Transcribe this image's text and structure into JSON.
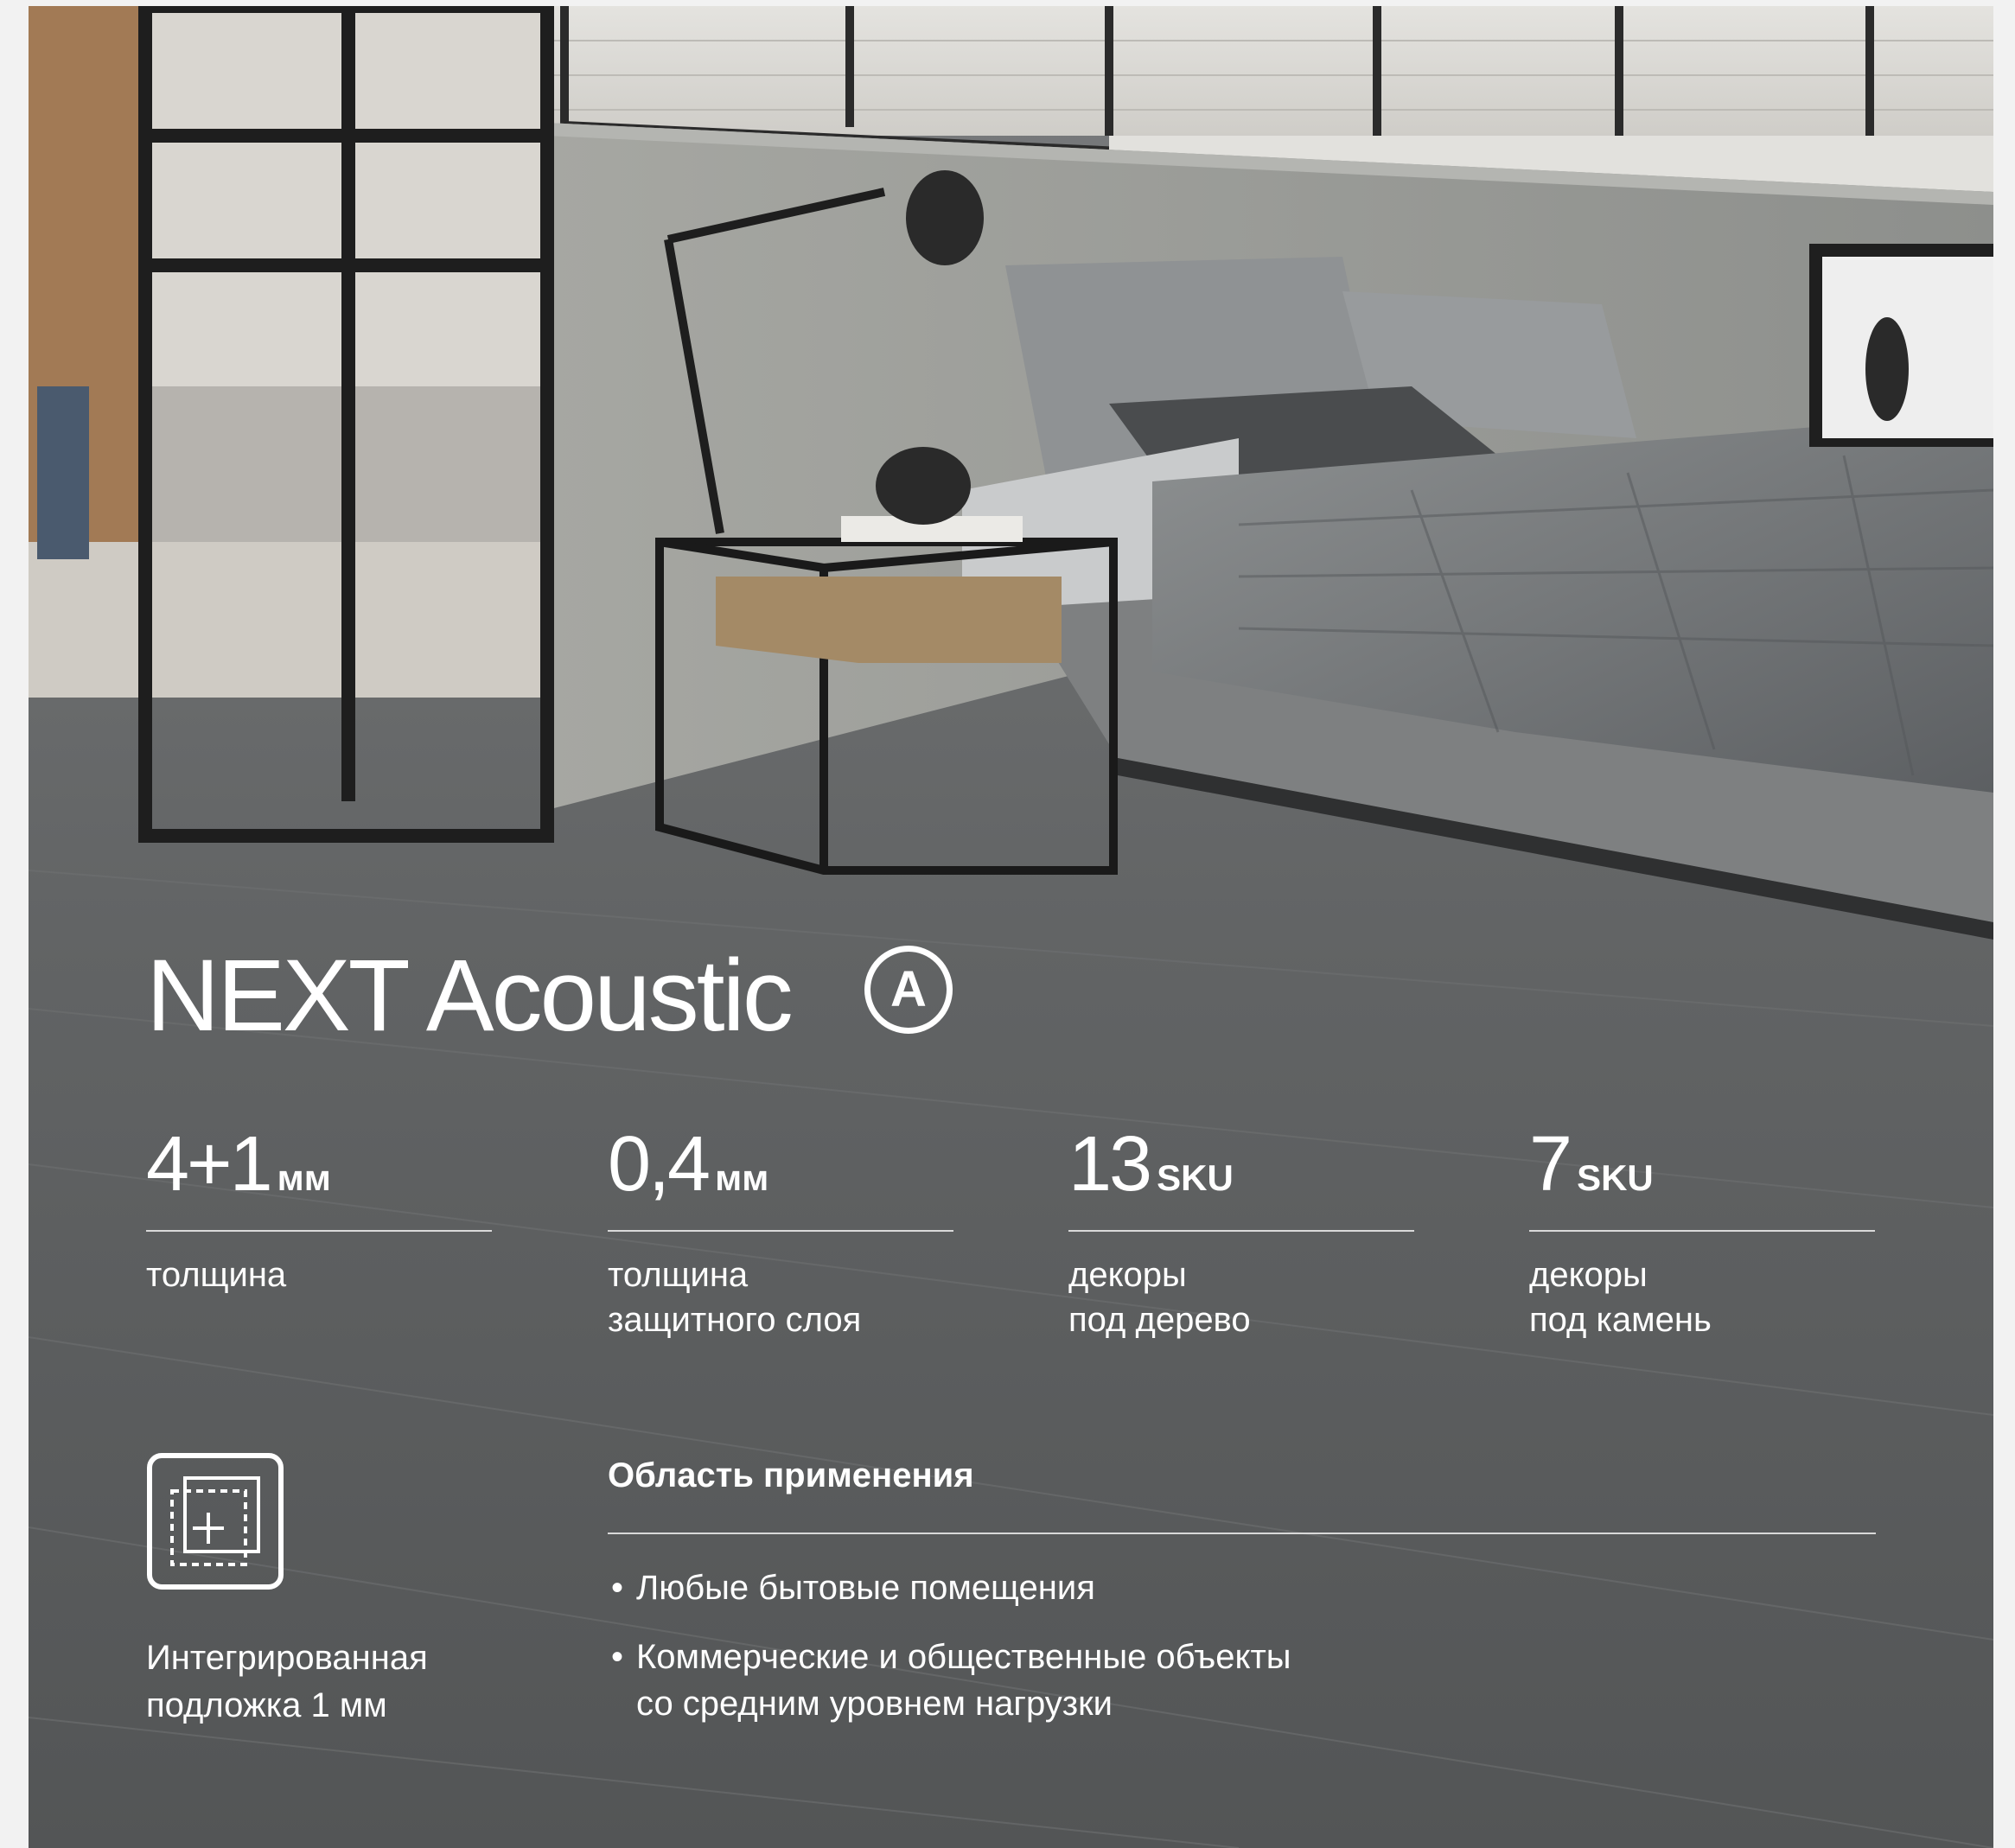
{
  "product": {
    "title": "NEXT Acoustic",
    "badge_letter": "A"
  },
  "stats": [
    {
      "value": "4+1",
      "unit": "мм",
      "label": "толщина"
    },
    {
      "value": "0,4",
      "unit": "мм",
      "label": "толщина\nзащитного слоя"
    },
    {
      "value": "13",
      "unit": "SKU",
      "label": "декоры\nпод дерево"
    },
    {
      "value": "7",
      "unit": "SKU",
      "label": "декоры\nпод камень"
    }
  ],
  "feature": {
    "icon": "underlay-layers-icon",
    "text": "Интегрированная\nподложка 1 мм"
  },
  "application": {
    "title": "Область применения",
    "bullet": "•",
    "items": [
      "Любые бытовые помещения",
      "Коммерческие и общественные объекты\nсо средним уровнем нагрузки"
    ]
  },
  "colors": {
    "floor": "#5f6162",
    "text": "#ffffff",
    "rule": "#d9d9d9"
  }
}
